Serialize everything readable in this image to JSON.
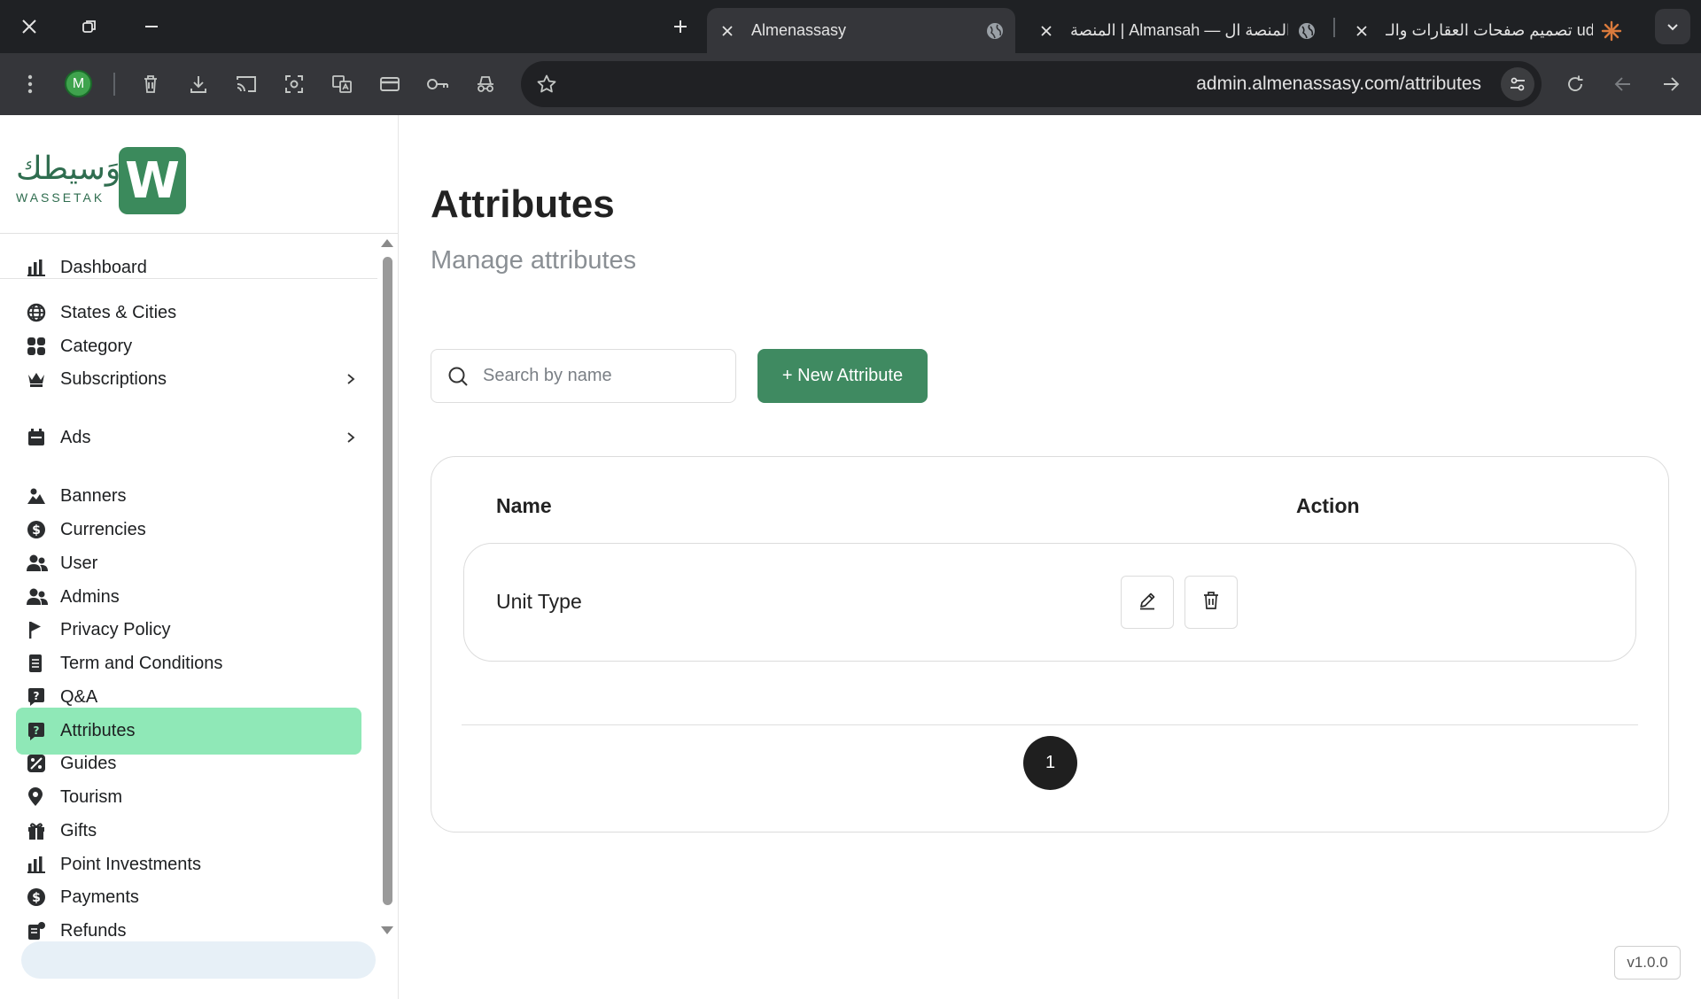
{
  "browser": {
    "tabs": [
      {
        "title": "Almenassasy",
        "active": true
      },
      {
        "title": "المنصة | Almansah — المنصة ال",
        "active": false
      },
      {
        "title": "تصميم صفحات العقارات والـ ude",
        "active": false
      }
    ],
    "avatar_letter": "M",
    "url": "admin.almenassasy.com/attributes"
  },
  "brand": {
    "script": "وَسيطك",
    "latin": "WASSETAK",
    "mark": "W",
    "color": "#3b8a5c"
  },
  "sidebar": {
    "items": [
      {
        "label": "Dashboard",
        "icon": "bar-chart-icon",
        "expandable": false,
        "active": false
      },
      {
        "label": "States & Cities",
        "icon": "globe-icon",
        "expandable": false,
        "active": false
      },
      {
        "label": "Category",
        "icon": "grid-icon",
        "expandable": false,
        "active": false
      },
      {
        "label": "Subscriptions",
        "icon": "crown-icon",
        "expandable": true,
        "active": false
      },
      {
        "label": "Ads",
        "icon": "calendar-icon",
        "expandable": true,
        "active": false
      },
      {
        "label": "Banners",
        "icon": "image-icon",
        "expandable": false,
        "active": false
      },
      {
        "label": "Currencies",
        "icon": "dollar-icon",
        "expandable": false,
        "active": false
      },
      {
        "label": "User",
        "icon": "users-icon",
        "expandable": false,
        "active": false
      },
      {
        "label": "Admins",
        "icon": "users-icon",
        "expandable": false,
        "active": false
      },
      {
        "label": "Privacy Policy",
        "icon": "flag-icon",
        "expandable": false,
        "active": false
      },
      {
        "label": "Term and Conditions",
        "icon": "document-icon",
        "expandable": false,
        "active": false
      },
      {
        "label": "Q&A",
        "icon": "question-icon",
        "expandable": false,
        "active": false
      },
      {
        "label": "Attributes",
        "icon": "question-icon",
        "expandable": false,
        "active": true
      },
      {
        "label": "Guides",
        "icon": "tag-icon",
        "expandable": false,
        "active": false
      },
      {
        "label": "Tourism",
        "icon": "pin-icon",
        "expandable": false,
        "active": false
      },
      {
        "label": "Gifts",
        "icon": "gift-icon",
        "expandable": false,
        "active": false
      },
      {
        "label": "Point Investments",
        "icon": "bar-chart-icon",
        "expandable": false,
        "active": false
      },
      {
        "label": "Payments",
        "icon": "dollar-icon",
        "expandable": false,
        "active": false
      },
      {
        "label": "Refunds",
        "icon": "refund-icon",
        "expandable": false,
        "active": false
      }
    ],
    "active_color": "#8fe8b7"
  },
  "main": {
    "title": "Attributes",
    "subtitle": "Manage attributes",
    "search_placeholder": "Search by name",
    "new_button": "+ New Attribute",
    "accent": "#3f8a61",
    "table": {
      "columns": [
        "Name",
        "Action"
      ],
      "rows": [
        {
          "name": "Unit Type"
        }
      ]
    },
    "pagination": {
      "current_page": "1"
    },
    "version": "v1.0.0"
  }
}
